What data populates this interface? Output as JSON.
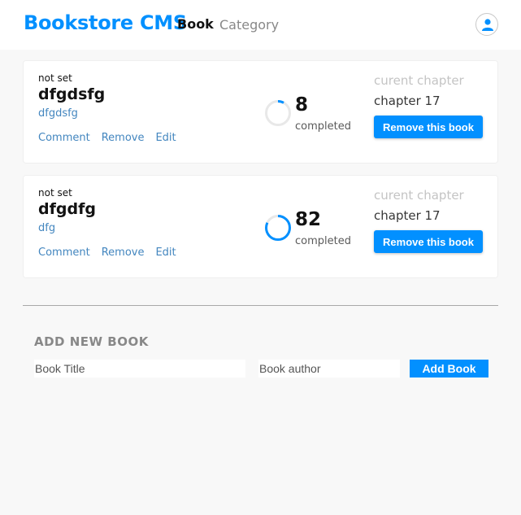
{
  "header": {
    "brand": "Bookstore CMS",
    "nav": {
      "book": "Book",
      "category": "Category"
    }
  },
  "books": [
    {
      "genre": "not set",
      "title": "dfgdsfg",
      "author": "dfgdsfg",
      "actions": {
        "comment": "Comment",
        "remove": "Remove",
        "edit": "Edit"
      },
      "progress": {
        "percent": "8",
        "fraction": 0.08,
        "completed_label": "completed"
      },
      "chapter": {
        "label": "curent chapter",
        "value": "chapter 17"
      },
      "remove_button": "Remove this book"
    },
    {
      "genre": "not set",
      "title": "dfgdfg",
      "author": "dfg",
      "actions": {
        "comment": "Comment",
        "remove": "Remove",
        "edit": "Edit"
      },
      "progress": {
        "percent": "82",
        "fraction": 0.82,
        "completed_label": "completed"
      },
      "chapter": {
        "label": "curent chapter",
        "value": "chapter 17"
      },
      "remove_button": "Remove this book"
    }
  ],
  "add_form": {
    "title": "ADD NEW BOOK",
    "title_placeholder": "Book Title",
    "author_placeholder": "Book author",
    "submit_label": "Add Book"
  },
  "colors": {
    "accent": "#0290ff",
    "link": "#4386bf",
    "track": "#e8e8e8"
  }
}
